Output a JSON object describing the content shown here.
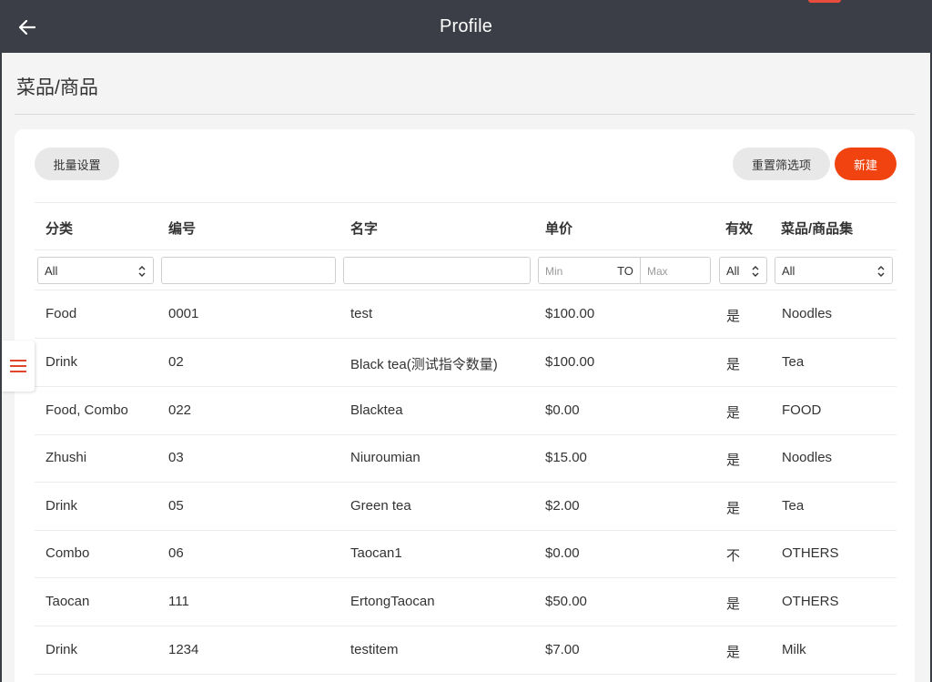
{
  "header": {
    "title": "Profile"
  },
  "page": {
    "title": "菜品/商品"
  },
  "toolbar": {
    "batch_label": "批量设置",
    "reset_label": "重置筛选项",
    "new_label": "新建"
  },
  "table": {
    "headers": {
      "category": "分类",
      "code": "编号",
      "name": "名字",
      "price": "单价",
      "valid": "有效",
      "collection": "菜品/商品集"
    },
    "filters": {
      "category_value": "All",
      "code_value": "",
      "name_value": "",
      "price_min_placeholder": "Min",
      "price_to": "TO",
      "price_max_placeholder": "Max",
      "valid_value": "All",
      "collection_value": "All"
    },
    "rows": [
      {
        "category": "Food",
        "code": "0001",
        "name": "test",
        "price": "$100.00",
        "valid": "是",
        "collection": "Noodles"
      },
      {
        "category": "Drink",
        "code": "02",
        "name": "Black tea(测试指令数量)",
        "price": "$100.00",
        "valid": "是",
        "collection": "Tea"
      },
      {
        "category": "Food, Combo",
        "code": "022",
        "name": "Blacktea",
        "price": "$0.00",
        "valid": "是",
        "collection": "FOOD"
      },
      {
        "category": "Zhushi",
        "code": "03",
        "name": "Niuroumian",
        "price": "$15.00",
        "valid": "是",
        "collection": "Noodles"
      },
      {
        "category": "Drink",
        "code": "05",
        "name": "Green tea",
        "price": "$2.00",
        "valid": "是",
        "collection": "Tea"
      },
      {
        "category": "Combo",
        "code": "06",
        "name": "Taocan1",
        "price": "$0.00",
        "valid": "不",
        "collection": "OTHERS"
      },
      {
        "category": "Taocan",
        "code": "111",
        "name": "ErtongTaocan",
        "price": "$50.00",
        "valid": "是",
        "collection": "OTHERS"
      },
      {
        "category": "Drink",
        "code": "1234",
        "name": "testitem",
        "price": "$7.00",
        "valid": "是",
        "collection": "Milk"
      }
    ]
  },
  "colors": {
    "accent": "#f0430f",
    "appbar": "#3b3e46",
    "menu_icon": "#e0452e"
  },
  "icons": {
    "back": "arrow-left-icon",
    "menu": "hamburger-menu-icon",
    "select": "chevron-up-down-icon"
  }
}
